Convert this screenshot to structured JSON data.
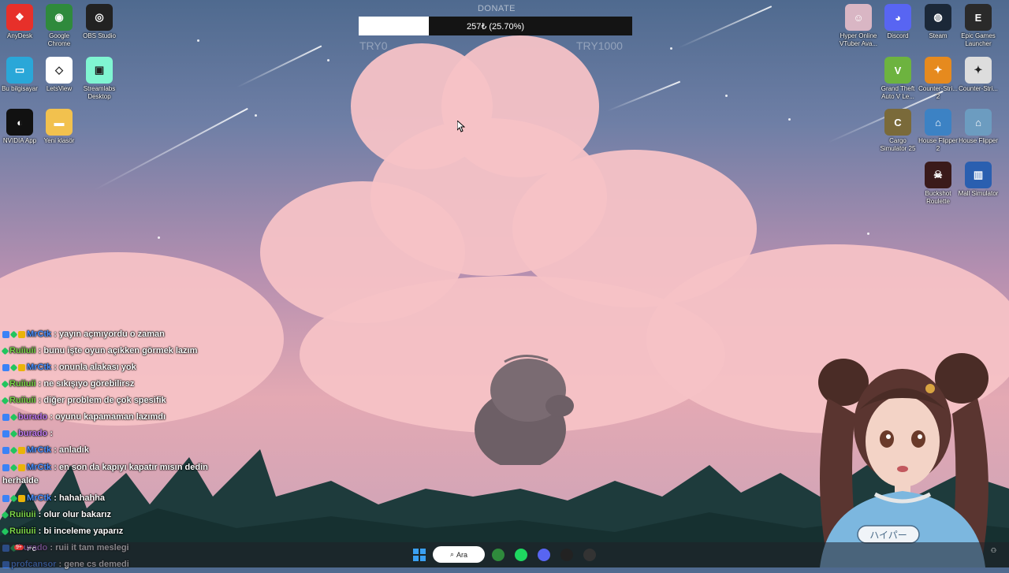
{
  "donation": {
    "title": "DONATE",
    "progress_text": "257₺ (25.70%)",
    "progress_fraction": 0.257,
    "min_label": "TRY0",
    "max_label": "TRY1000"
  },
  "desktop_left": [
    {
      "label": "AnyDesk",
      "icon": "anydesk-icon",
      "color": "#e7302a",
      "glyph": "❖"
    },
    {
      "label": "Google Chrome",
      "icon": "chrome-icon",
      "color": "#2f8a3c",
      "glyph": "◉"
    },
    {
      "label": "OBS Studio",
      "icon": "obs-icon",
      "color": "#222222",
      "glyph": "◎"
    },
    {
      "label": "Bu bilgisayar",
      "icon": "computer-icon",
      "color": "#2aa7d8",
      "glyph": "▭"
    },
    {
      "label": "LetsView",
      "icon": "letsview-icon",
      "color": "#ffffff",
      "glyph": "◇"
    },
    {
      "label": "Streamlabs Desktop",
      "icon": "streamlabs-icon",
      "color": "#80f5d2",
      "glyph": "▣"
    },
    {
      "label": "NVIDIA App",
      "icon": "nvidia-icon",
      "color": "#111111",
      "glyph": "◐"
    },
    {
      "label": "Yeni klasör",
      "icon": "folder-icon",
      "color": "#f2c14e",
      "glyph": "▬"
    }
  ],
  "desktop_right": [
    {
      "label": "Hyper Online VTuber Ava...",
      "icon": "vtuber-avatar-icon",
      "color": "#d9b6c4",
      "glyph": "☺"
    },
    {
      "label": "Discord",
      "icon": "discord-icon",
      "color": "#5865f2",
      "glyph": "◕"
    },
    {
      "label": "Steam",
      "icon": "steam-icon",
      "color": "#1b2838",
      "glyph": "◍"
    },
    {
      "label": "Epic Games Launcher",
      "icon": "epic-games-icon",
      "color": "#2a2a2a",
      "glyph": "E"
    },
    {
      "label": "Grand Theft Auto V Le...",
      "icon": "gta-icon",
      "color": "#6db33f",
      "glyph": "V"
    },
    {
      "label": "Counter-Stri... 2",
      "icon": "counter-strike-2-icon",
      "color": "#e68a1e",
      "glyph": "✦"
    },
    {
      "label": "Counter-Stri...",
      "icon": "counter-strike-icon",
      "color": "#dddddd",
      "glyph": "✦"
    },
    {
      "label": "Cargo Simulator 25",
      "icon": "cargo-simulator-icon",
      "color": "#7a6a3a",
      "glyph": "C"
    },
    {
      "label": "House Flipper 2",
      "icon": "house-flipper-2-icon",
      "color": "#3c82c4",
      "glyph": "⌂"
    },
    {
      "label": "House Flipper",
      "icon": "house-flipper-icon",
      "color": "#6c9cc0",
      "glyph": "⌂"
    },
    {
      "label": "Buckshot Roulette",
      "icon": "buckshot-roulette-icon",
      "color": "#3a1a1a",
      "glyph": "☠"
    },
    {
      "label": "Mall Simulator",
      "icon": "mall-simulator-icon",
      "color": "#2a5fb0",
      "glyph": "▥"
    }
  ],
  "chat": [
    {
      "badges": [
        "blue",
        "green",
        "gold"
      ],
      "user": "MrCtk",
      "color": "#4a90ff",
      "text": ": yayın açmıyordu o zaman"
    },
    {
      "badges": [
        "green"
      ],
      "user": "Ruiiuii",
      "color": "#7cd64a",
      "text": ": bunu işte oyun açıkken görmek lazım"
    },
    {
      "badges": [
        "blue",
        "green",
        "gold"
      ],
      "user": "MrCtk",
      "color": "#4a90ff",
      "text": ": onunla alakası yok"
    },
    {
      "badges": [
        "green"
      ],
      "user": "Ruiiuii",
      "color": "#7cd64a",
      "text": ": ne sıkışıyo görebilirsz"
    },
    {
      "badges": [
        "green"
      ],
      "user": "Ruiiuii",
      "color": "#7cd64a",
      "text": ": diğer problem de çok spesifik"
    },
    {
      "badges": [
        "blue",
        "green"
      ],
      "user": "burado",
      "color": "#c27cf0",
      "text": ": oyunu kapamaman lazımdı"
    },
    {
      "badges": [
        "blue",
        "green"
      ],
      "user": "burado",
      "color": "#c27cf0",
      "text": ":"
    },
    {
      "badges": [
        "blue",
        "green",
        "gold"
      ],
      "user": "MrCtk",
      "color": "#4a90ff",
      "text": ": anladık"
    },
    {
      "badges": [
        "blue",
        "green",
        "gold"
      ],
      "user": "MrCtk",
      "color": "#4a90ff",
      "text": ": en son da kapıyı kapatır mısın dedin herhalde"
    },
    {
      "badges": [
        "blue",
        "green",
        "gold"
      ],
      "user": "MrCtk",
      "color": "#4a90ff",
      "text": ": hahahahha"
    },
    {
      "badges": [
        "green"
      ],
      "user": "Ruiiuii",
      "color": "#7cd64a",
      "text": ": olur olur bakarız"
    },
    {
      "badges": [
        "green"
      ],
      "user": "Ruiiuii",
      "color": "#7cd64a",
      "text": ": bi inceleme yaparız"
    },
    {
      "badges": [
        "blue",
        "green"
      ],
      "user": "burado",
      "color": "#c27cf0",
      "text": ": ruii it tam meslegi"
    },
    {
      "badges": [
        "blue"
      ],
      "user": "profcansor",
      "color": "#4a90ff",
      "text": ": gene cs demedi"
    }
  ],
  "taskbar": {
    "search_label": "Ara",
    "weather": "7°C",
    "weather_badge": "9+",
    "avatar_shirt_text": "ハイパー",
    "apps": [
      {
        "icon": "windows-start-icon",
        "color": "#3aa0f2"
      },
      {
        "icon": "chrome-icon",
        "color": "#2f8a3c"
      },
      {
        "icon": "spotify-icon",
        "color": "#1ed760"
      },
      {
        "icon": "discord-icon",
        "color": "#5865f2"
      },
      {
        "icon": "capcut-icon",
        "color": "#222222"
      },
      {
        "icon": "obs-icon",
        "color": "#333333"
      }
    ]
  }
}
